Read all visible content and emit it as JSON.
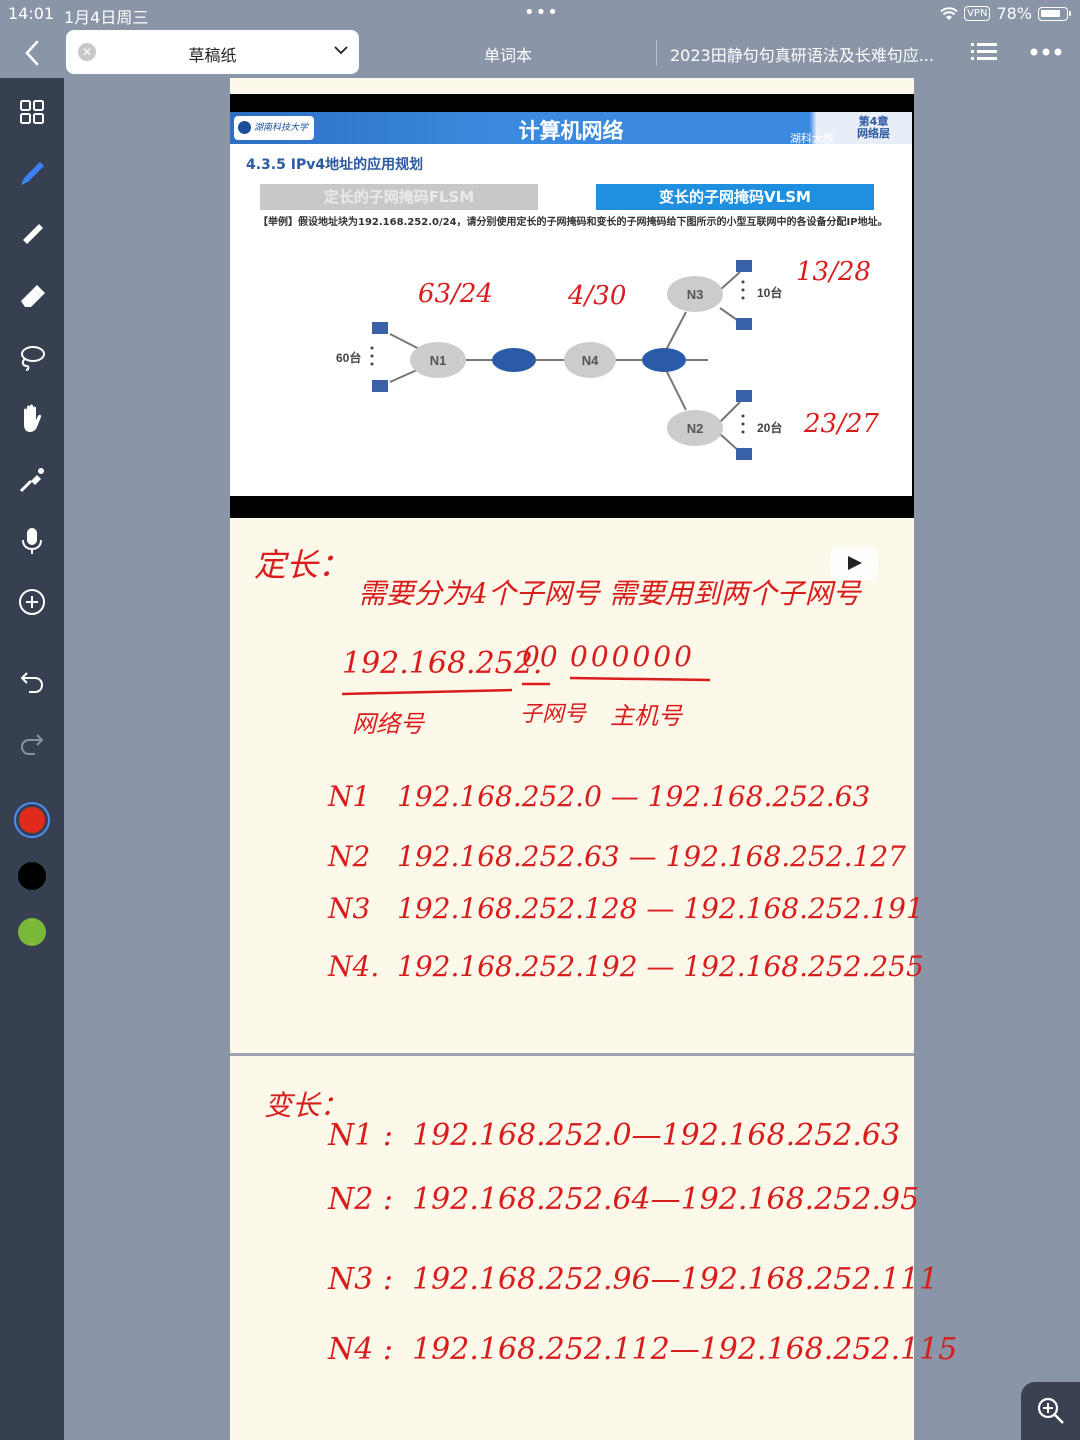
{
  "status": {
    "time": "14:01",
    "date": "1月4日周三",
    "vpn": "VPN",
    "battery": "78%",
    "battery_level": 0.78
  },
  "tabs": {
    "active": "草稿纸",
    "second": "单词本",
    "third": "2023田静句句真研语法及长难句应..."
  },
  "slide": {
    "logo": "湖南科技大学",
    "title": "计算机网络",
    "chapter": "第4章\n网络层",
    "org": "湖科大教",
    "section": "4.3.5 IPv4地址的应用规划",
    "flsm": "定长的子网掩码FLSM",
    "vlsm": "变长的子网掩码VLSM",
    "example": "【举例】假设地址块为192.168.252.0/24，请分别使用定长的子网掩码和变长的子网掩码给下图所示的小型互联网中的各设备分配IP地址。",
    "nodes": {
      "n1": "N1",
      "n2": "N2",
      "n3": "N3",
      "n4": "N4"
    },
    "counts": {
      "n1": "60台",
      "n2": "20台",
      "n3": "10台"
    },
    "annotations": {
      "n1": "63/24",
      "n4": "4/30",
      "n3": "13/28",
      "n2": "23/27"
    }
  },
  "notes": {
    "flsm_heading": "定长：",
    "flsm_need": "需要分为4个子网号  需要用到两个子网号",
    "addr_net": "192.168.252.",
    "addr_sub": "00",
    "addr_host": "000000",
    "label_net": "网络号",
    "label_sub": "子网号",
    "label_host": "主机号",
    "flsm_rows": [
      {
        "n": "N1",
        "range": "192.168.252.0 — 192.168.252.63"
      },
      {
        "n": "N2",
        "range": "192.168.252.63 — 192.168.252.127"
      },
      {
        "n": "N3",
        "range": "192.168.252.128 — 192.168.252.191"
      },
      {
        "n": "N4.",
        "range": "192.168.252.192 — 192.168.252.255"
      }
    ],
    "vlsm_heading": "变长：",
    "vlsm_rows": [
      {
        "n": "N1 :",
        "range": "192.168.252.0—192.168.252.63"
      },
      {
        "n": "N2 :",
        "range": "192.168.252.64—192.168.252.95"
      },
      {
        "n": "N3 :",
        "range": "192.168.252.96—192.168.252.111"
      },
      {
        "n": "N4 :",
        "range": "192.168.252.112—192.168.252.115"
      }
    ]
  },
  "colors": {
    "ink": "#d91c1c",
    "swatch_red": "#e02b1c",
    "swatch_black": "#000000",
    "swatch_green": "#7ab83a"
  }
}
